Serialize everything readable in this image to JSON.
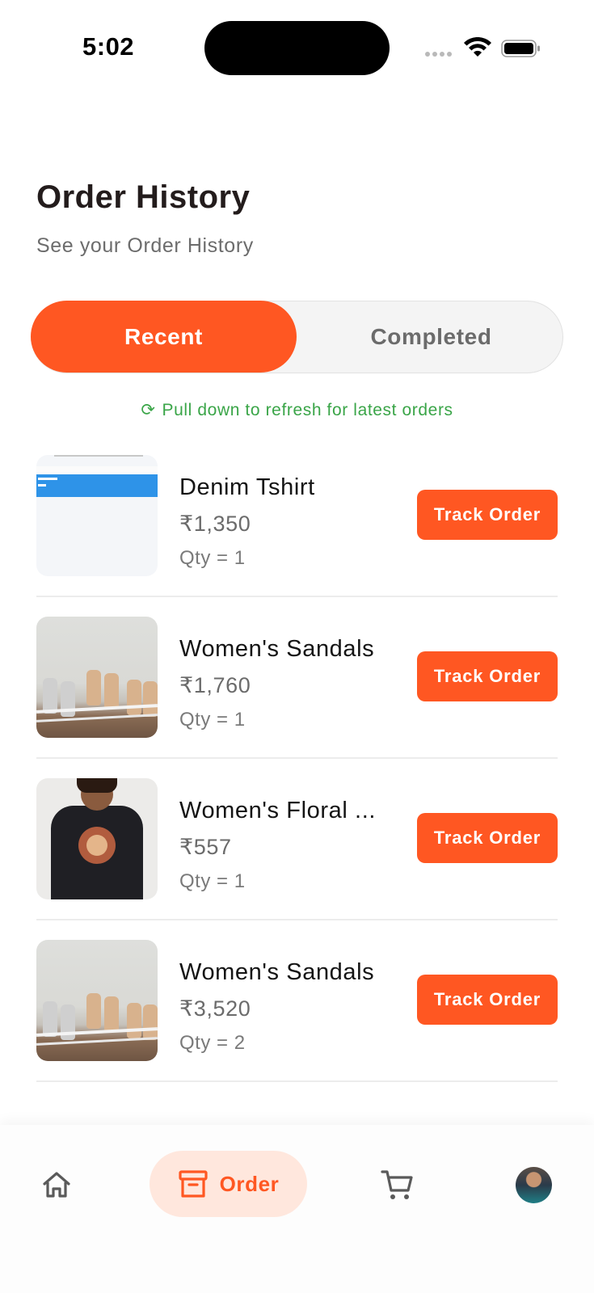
{
  "status_bar": {
    "time": "5:02"
  },
  "header": {
    "title": "Order History",
    "subtitle": "See your Order History"
  },
  "tabs": [
    {
      "label": "Recent",
      "selected": true
    },
    {
      "label": "Completed",
      "selected": false
    }
  ],
  "refresh_hint": "Pull down to refresh for latest orders",
  "orders": [
    {
      "name": "Denim Tshirt",
      "price": "₹1,350",
      "qty": "Qty = 1",
      "action": "Track Order",
      "thumb": "screenshot-image"
    },
    {
      "name": "Women's Sandals",
      "price": "₹1,760",
      "qty": "Qty = 1",
      "action": "Track Order",
      "thumb": "sandals-photo"
    },
    {
      "name": "Women's Floral ...",
      "price": "₹557",
      "qty": "Qty = 1",
      "action": "Track Order",
      "thumb": "tshirt-photo"
    },
    {
      "name": "Women's Sandals",
      "price": "₹3,520",
      "qty": "Qty = 2",
      "action": "Track Order",
      "thumb": "sandals-photo"
    }
  ],
  "bottom_nav": {
    "items": [
      {
        "icon": "home-icon"
      },
      {
        "icon": "order-box-icon",
        "label": "Order",
        "active": true
      },
      {
        "icon": "cart-icon"
      },
      {
        "icon": "avatar"
      }
    ]
  },
  "colors": {
    "accent": "#ff5722",
    "accent_soft": "#ffe7dd",
    "refresh_green": "#3aa548"
  }
}
